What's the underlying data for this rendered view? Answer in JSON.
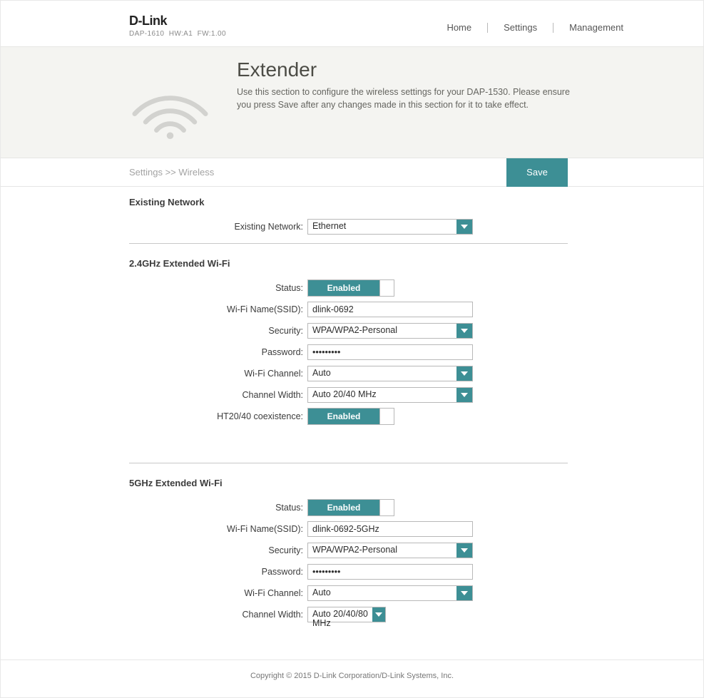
{
  "header": {
    "brand": "D-Link",
    "model": "DAP-1610",
    "hw_label": "HW:A1",
    "fw_label": "FW:1.00",
    "nav": {
      "home": "Home",
      "settings": "Settings",
      "management": "Management"
    }
  },
  "hero": {
    "title": "Extender",
    "desc_prefix": "Use this section to configure the wireless settings for your ",
    "desc_model": "DAP-1530",
    "desc_suffix": ". Please ensure you press Save after any changes made in this section for it to take effect."
  },
  "breadcrumb": "Settings >> Wireless",
  "save_label": "Save",
  "sections": {
    "existing": {
      "title": "Existing Network",
      "label": "Existing Network:",
      "value": "Ethernet"
    },
    "g24": {
      "title": "2.4GHz Extended Wi-Fi",
      "status_label": "Status:",
      "status_value": "Enabled",
      "ssid_label": "Wi-Fi Name(SSID):",
      "ssid_value": "dlink-0692",
      "security_label": "Security:",
      "security_value": "WPA/WPA2-Personal",
      "password_label": "Password:",
      "password_value": "•••••••••",
      "channel_label": "Wi-Fi Channel:",
      "channel_value": "Auto",
      "width_label": "Channel Width:",
      "width_value": "Auto 20/40 MHz",
      "coex_label": "HT20/40 coexistence:",
      "coex_value": "Enabled"
    },
    "g5": {
      "title": "5GHz Extended Wi-Fi",
      "status_label": "Status:",
      "status_value": "Enabled",
      "ssid_label": "Wi-Fi Name(SSID):",
      "ssid_value": "dlink-0692-5GHz",
      "security_label": "Security:",
      "security_value": "WPA/WPA2-Personal",
      "password_label": "Password:",
      "password_value": "•••••••••",
      "channel_label": "Wi-Fi Channel:",
      "channel_value": "Auto",
      "width_label": "Channel Width:",
      "width_value": "Auto 20/40/80 MHz"
    }
  },
  "footer": "Copyright © 2015 D-Link Corporation/D-Link Systems, Inc."
}
